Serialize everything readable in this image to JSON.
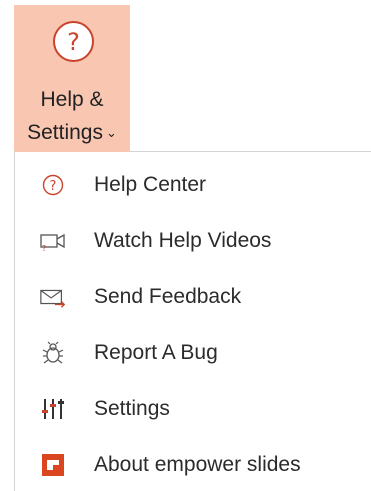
{
  "ribbon": {
    "help_icon_glyph": "?",
    "label_line1": "Help &",
    "label_line2": "Settings",
    "caret": "⌄",
    "active_bg": "#f8c6b1",
    "accent": "#c8442c"
  },
  "menu": {
    "items": [
      {
        "label": "Help Center",
        "icon": "help-circle-icon"
      },
      {
        "label": "Watch Help Videos",
        "icon": "video-camera-icon"
      },
      {
        "label": "Send Feedback",
        "icon": "envelope-arrow-icon"
      },
      {
        "label": "Report A Bug",
        "icon": "bug-icon"
      },
      {
        "label": "Settings",
        "icon": "sliders-icon"
      },
      {
        "label": "About empower slides",
        "icon": "empower-logo-icon"
      }
    ]
  }
}
